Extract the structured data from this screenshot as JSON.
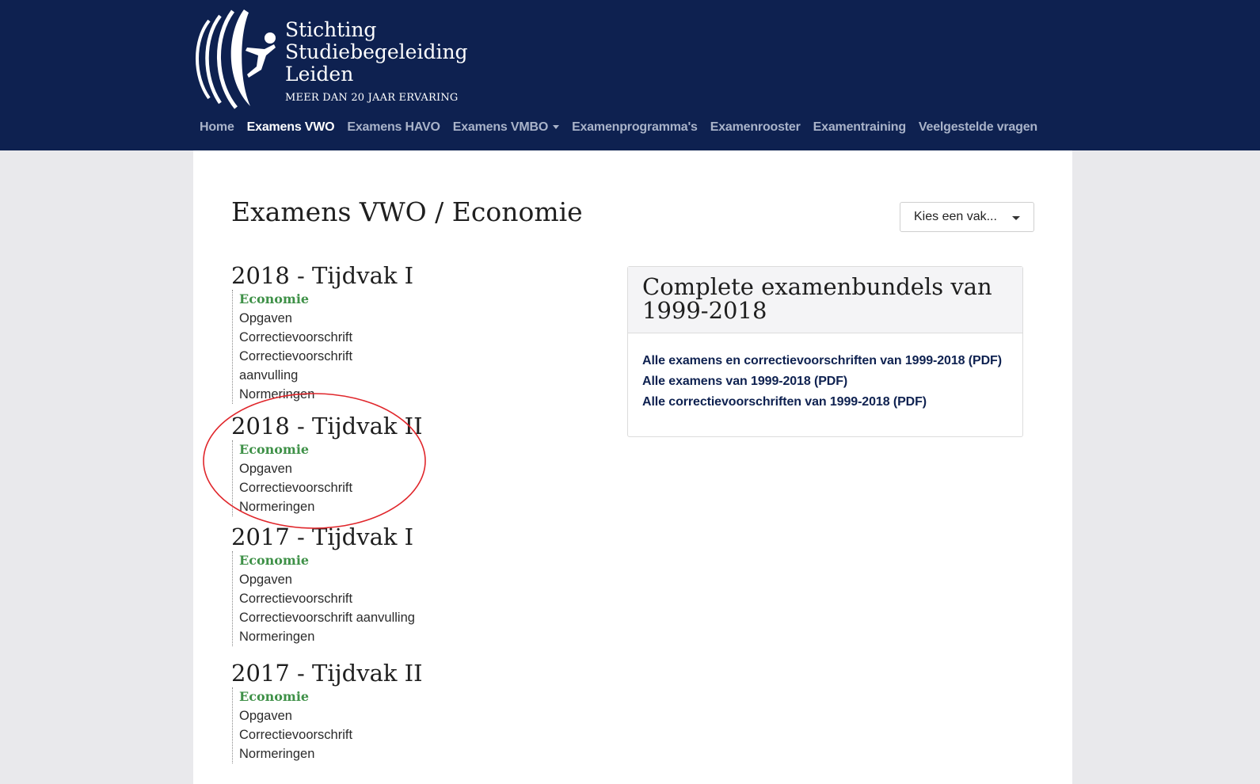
{
  "header": {
    "logo_lines": [
      "Stichting",
      "Studiebegeleiding",
      "Leiden"
    ],
    "logo_tagline": "MEER DAN 20 JAAR ERVARING",
    "logo_icon": "figure-rings-icon",
    "nav": [
      {
        "label": "Home"
      },
      {
        "label": "Examens VWO",
        "active": true
      },
      {
        "label": "Examens HAVO"
      },
      {
        "label": "Examens VMBO",
        "dropdown": true
      },
      {
        "label": "Examenprogramma's"
      },
      {
        "label": "Examenrooster"
      },
      {
        "label": "Examentraining"
      },
      {
        "label": "Veelgestelde vragen"
      }
    ],
    "bg_color": "#0e2150"
  },
  "main": {
    "title": "Examens VWO / Economie",
    "subject_select": {
      "label": "Kies een vak..."
    },
    "exams": [
      {
        "heading": "2018 - Tijdvak I",
        "subject": "Economie",
        "links": [
          "Opgaven",
          "Correctievoorschrift",
          "Correctievoorschrift",
          "aanvulling",
          "Normeringen"
        ]
      },
      {
        "heading": "2018 - Tijdvak II",
        "subject": "Economie",
        "links": [
          "Opgaven",
          "Correctievoorschrift",
          "Normeringen"
        ]
      },
      {
        "heading": "2017 - Tijdvak I",
        "subject": "Economie",
        "links": [
          "Opgaven",
          "Correctievoorschrift",
          "Correctievoorschrift aanvulling",
          "Normeringen"
        ]
      },
      {
        "heading": "2017 - Tijdvak II",
        "subject": "Economie",
        "links": [
          "Opgaven",
          "Correctievoorschrift",
          "Normeringen"
        ]
      }
    ],
    "bundles": {
      "heading": "Complete examenbundels van 1999-2018",
      "links": [
        "Alle examens en correctievoorschriften van 1999-2018 (PDF)",
        "Alle examens van 1999-2018 (PDF)",
        "Alle correctievoorschriften van 1999-2018 (PDF)"
      ]
    },
    "subject_color": "#3f9148",
    "annotation_color": "#e0262b"
  }
}
